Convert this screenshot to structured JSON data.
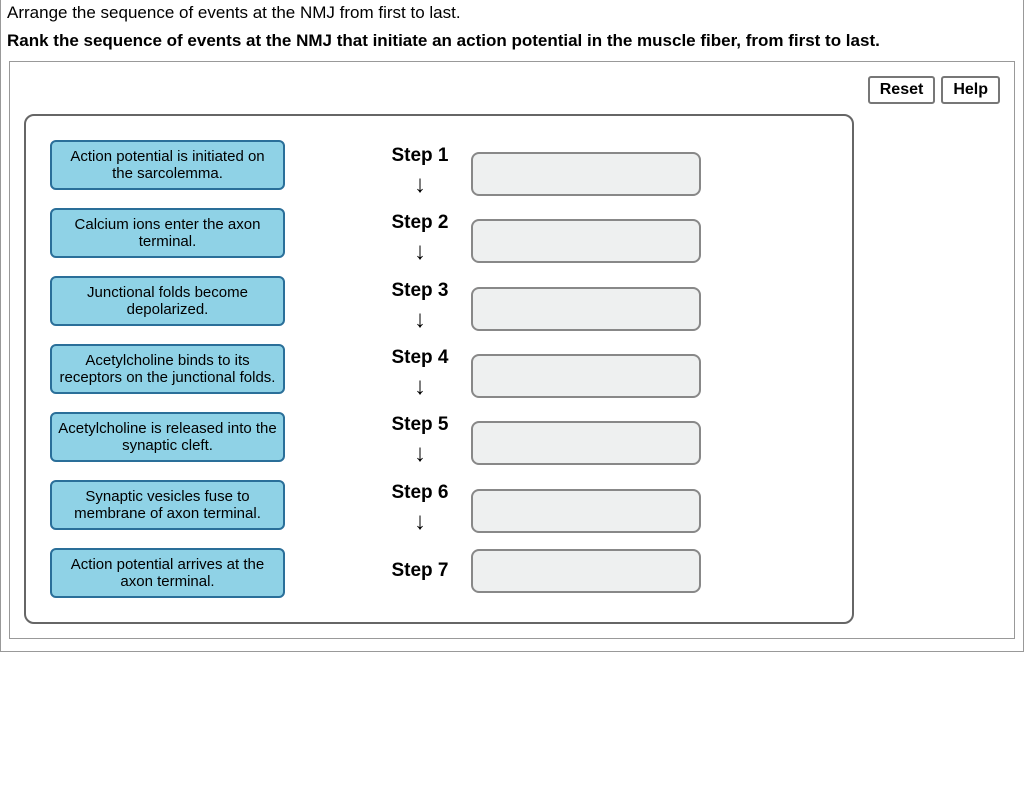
{
  "question": {
    "title": "Arrange the sequence of events at the NMJ from first to last.",
    "instruction": "Rank the sequence of events at the NMJ that initiate an action potential in the muscle fiber, from first to last."
  },
  "buttons": {
    "reset": "Reset",
    "help": "Help"
  },
  "tiles": [
    "Action potential is initiated on the sarcolemma.",
    "Calcium ions enter the axon terminal.",
    "Junctional folds become depolarized.",
    "Acetylcholine binds to its receptors on the junctional folds.",
    "Acetylcholine is released into the synaptic cleft.",
    "Synaptic vesicles fuse to membrane of axon terminal.",
    "Action potential arrives at the axon terminal."
  ],
  "steps": [
    "Step 1",
    "Step 2",
    "Step 3",
    "Step 4",
    "Step 5",
    "Step 6",
    "Step 7"
  ],
  "arrow": "↓"
}
